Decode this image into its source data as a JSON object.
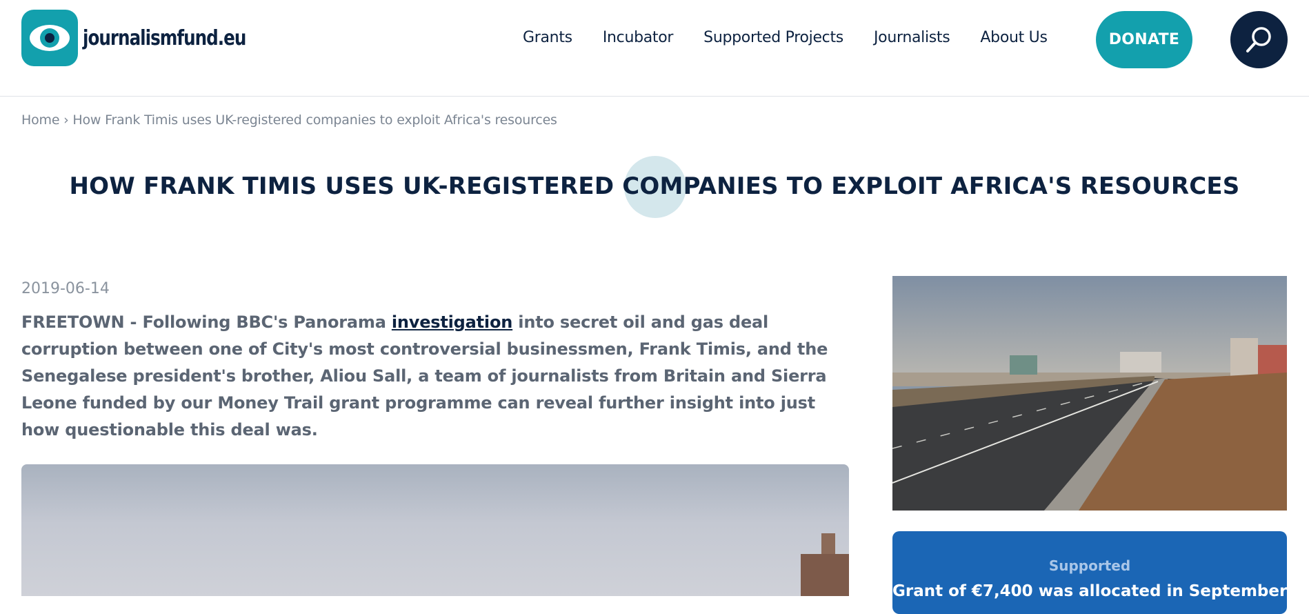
{
  "header": {
    "logo_text": "journalismfund.eu",
    "nav": [
      "Grants",
      "Incubator",
      "Supported Projects",
      "Journalists",
      "About Us"
    ],
    "donate_label": "DONATE"
  },
  "breadcrumb": {
    "home": "Home",
    "separator": "›",
    "current": "How Frank Timis uses UK-registered companies to exploit Africa's resources"
  },
  "article": {
    "title": "HOW FRANK TIMIS USES UK-REGISTERED COMPANIES TO EXPLOIT AFRICA'S RESOURCES",
    "date": "2019-06-14",
    "lead_location": "FREETOWN -",
    "lead_before_link": "Following BBC's Panorama",
    "lead_link": "investigation",
    "lead_after_link": "into secret oil and gas deal corruption between one of City's most controversial businessmen, Frank Timis, and the Senegalese president's brother, Aliou Sall, a team of journalists from Britain and Sierra Leone funded by our Money Trail grant programme can reveal further insight into just how questionable this deal was."
  },
  "sidebar": {
    "card_label": "Supported",
    "card_text": "Grant of €7,400 was allocated in September"
  },
  "colors": {
    "brand_teal": "#13a0ad",
    "navy": "#0d2240",
    "card_blue": "#1b66b5"
  }
}
